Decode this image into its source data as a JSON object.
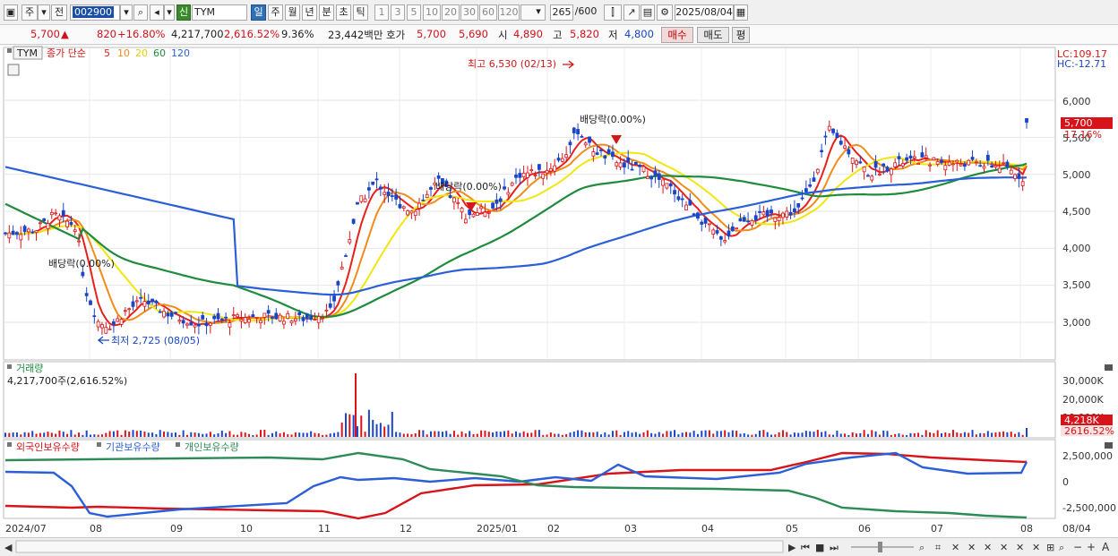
{
  "toolbar": {
    "period_label": "주",
    "prev_label": "전",
    "code": "002900",
    "name_tag": "신",
    "stock_name": "TYM",
    "tf_buttons": [
      "일",
      "주",
      "월",
      "년",
      "분",
      "초",
      "틱"
    ],
    "num_buttons": [
      "1",
      "3",
      "5",
      "10",
      "20",
      "30",
      "60",
      "120"
    ],
    "count": "265",
    "count_total": "/600",
    "date": "2025/08/04"
  },
  "quote": {
    "price": "5,700",
    "arrow": "▲",
    "change": "820",
    "change_pct": "+16.80%",
    "volume": "4,217,700",
    "volume_pct": "2,616.52%",
    "turnover": "9.36%",
    "amount": "23,442백만",
    "hoga_label": "호가",
    "ask": "5,700",
    "bid": "5,690",
    "open_label": "시",
    "open": "4,890",
    "high_label": "고",
    "high": "5,820",
    "low_label": "저",
    "low": "4,800",
    "buy_label": "매수",
    "sell_label": "매도",
    "eval_label": "평"
  },
  "price_panel": {
    "tag": "TYM",
    "indicator": "종가 단순",
    "ma_periods": [
      "5",
      "10",
      "20",
      "60",
      "120"
    ],
    "ma_colors": [
      "#e8201c",
      "#ef8c1a",
      "#f2e60e",
      "#1e8c3c",
      "#2b5fd8"
    ],
    "lc": "LC:109.17",
    "hc": "HC:-12.71",
    "y_ticks": [
      "6,000",
      "5,500",
      "5,000",
      "4,500",
      "4,000",
      "3,500",
      "3,000"
    ],
    "last_price": "5,700",
    "last_pct": "17.16%",
    "annotations": {
      "high": "최고 6,530 (02/13)",
      "low": "최저 2,725 (08/05)",
      "div1": "배당락(0.00%)",
      "div2": "배당락(0.00%)",
      "div3": "배당락(0.00%)"
    }
  },
  "volume_panel": {
    "title": "거래량",
    "value": "4,217,700주(2,616.52%)",
    "y_ticks": [
      "30,000K",
      "20,000K",
      "10,000K"
    ],
    "last": "4,218K",
    "last_pct": "2616.52%"
  },
  "holdings_panel": {
    "series": [
      "외국인보유수량",
      "기관보유수량",
      "개인보유수량"
    ],
    "colors": [
      "#d7141a",
      "#2c5fd6",
      "#2e8b57"
    ],
    "y_ticks": [
      "2,500,000",
      "0",
      "-2,500,000"
    ]
  },
  "x_axis": [
    "2024/07",
    "08",
    "09",
    "10",
    "11",
    "12",
    "2025/01",
    "02",
    "03",
    "04",
    "05",
    "06",
    "07",
    "08"
  ],
  "x_axis_right": "08/04"
}
